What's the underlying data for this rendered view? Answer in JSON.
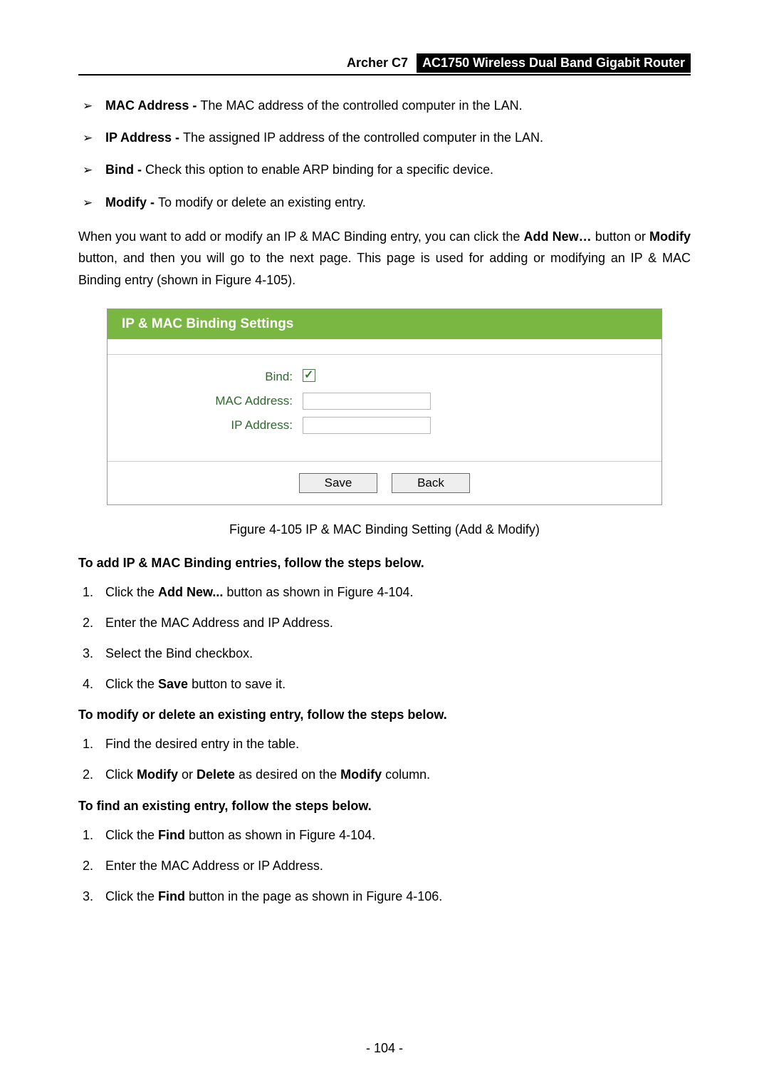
{
  "header": {
    "model": "Archer C7",
    "product": "AC1750 Wireless Dual Band Gigabit Router"
  },
  "bullets": [
    {
      "label": "MAC Address - ",
      "text": "The MAC address of the controlled computer in the LAN."
    },
    {
      "label": "IP Address - ",
      "text": "The assigned IP address of the controlled computer in the LAN."
    },
    {
      "label": "Bind - ",
      "text": "Check this option to enable ARP binding for a specific device."
    },
    {
      "label": "Modify - ",
      "text": "To modify or delete an existing entry."
    }
  ],
  "para1": {
    "p1": "When you want to add or modify an IP & MAC Binding entry, you can click the ",
    "b1": "Add New…",
    "p2": " button or ",
    "b2": "Modify",
    "p3": " button, and then you will go to the next page. This page is used for adding or modifying an IP & MAC Binding entry (shown in Figure 4-105)."
  },
  "panel": {
    "title": "IP & MAC Binding Settings",
    "labels": {
      "bind": "Bind:",
      "mac": "MAC Address:",
      "ip": "IP Address:"
    },
    "buttons": {
      "save": "Save",
      "back": "Back"
    }
  },
  "caption": "Figure 4-105 IP & MAC Binding Setting (Add & Modify)",
  "section1": {
    "title": "To add IP & MAC Binding entries, follow the steps below.",
    "items": [
      {
        "p1": "Click the ",
        "b1": "Add New...",
        "p2": " button as shown in Figure 4-104."
      },
      {
        "p1": "Enter the MAC Address and IP Address."
      },
      {
        "p1": "Select the Bind checkbox."
      },
      {
        "p1": "Click the ",
        "b1": "Save",
        "p2": " button to save it."
      }
    ]
  },
  "section2": {
    "title": "To modify or delete an existing entry, follow the steps below.",
    "items": [
      {
        "p1": "Find the desired entry in the table."
      },
      {
        "p1": "Click ",
        "b1": "Modify",
        "p2": " or ",
        "b2": "Delete",
        "p3": " as desired on the ",
        "b3": "Modify",
        "p4": " column."
      }
    ]
  },
  "section3": {
    "title": "To find an existing entry, follow the steps below.",
    "items": [
      {
        "p1": "Click the ",
        "b1": "Find",
        "p2": " button as shown in Figure 4-104."
      },
      {
        "p1": "Enter the MAC Address or IP Address."
      },
      {
        "p1": "Click the ",
        "b1": "Find",
        "p2": " button in the page as shown in Figure 4-106."
      }
    ]
  },
  "page_number": "- 104 -"
}
